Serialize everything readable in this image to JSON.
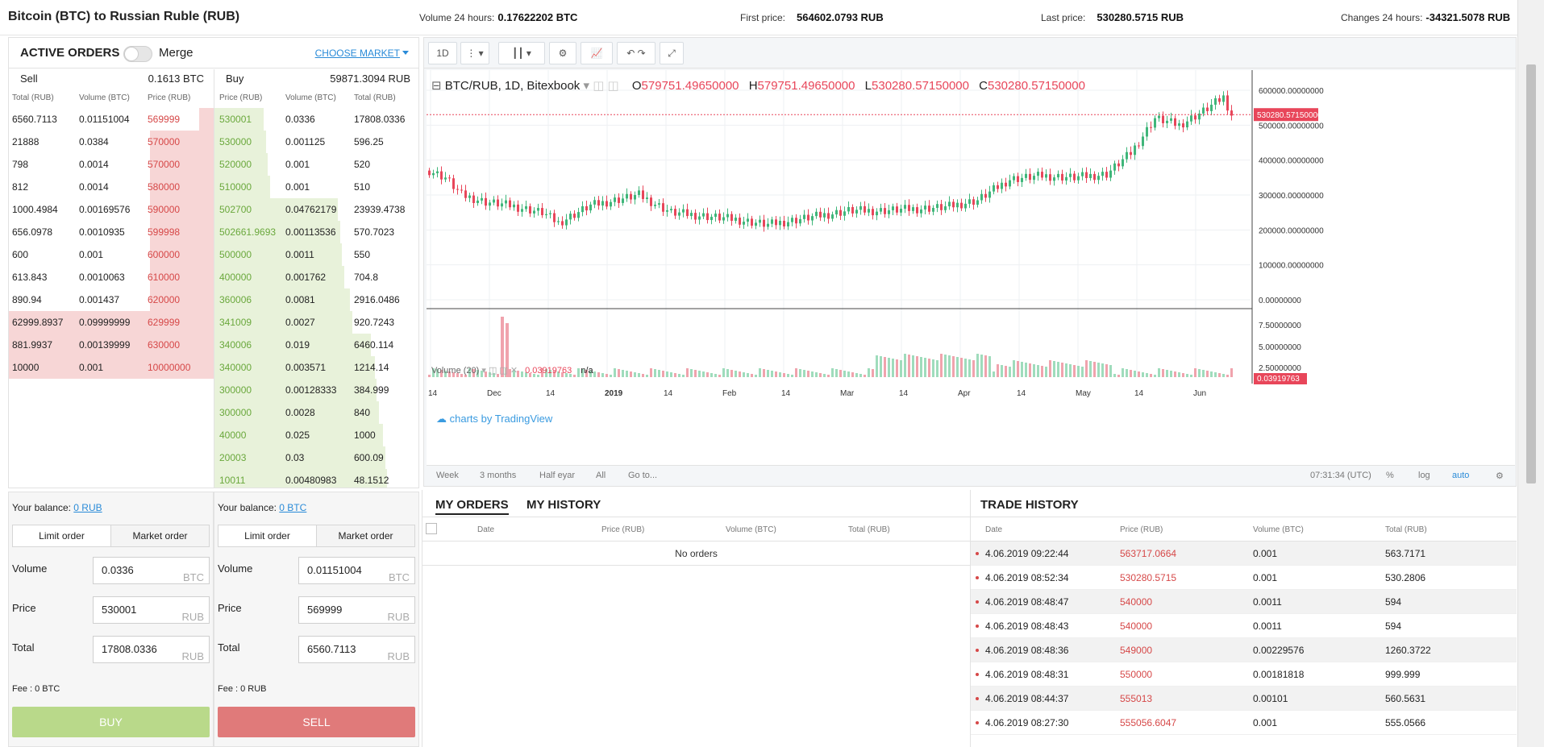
{
  "header": {
    "title": "Bitcoin (BTC) to Russian Ruble (RUB)",
    "volume_label": "Volume 24 hours:",
    "volume_value": "0.17622202 BTC",
    "first_label": "First price:",
    "first_value": "564602.0793 RUB",
    "last_label": "Last price:",
    "last_value": "530280.5715 RUB",
    "change_label": "Changes 24 hours:",
    "change_value": "-34321.5078 RUB"
  },
  "orders": {
    "title": "ACTIVE ORDERS",
    "merge_label": "Merge",
    "choose_market": "CHOOSE MARKET",
    "sell": {
      "label": "Sell",
      "amount": "0.1613 BTC",
      "columns": [
        "Total (RUB)",
        "Volume (BTC)",
        "Price (RUB)"
      ],
      "rows": [
        {
          "total": "6560.7113",
          "volume": "0.01151004",
          "price": "569999",
          "depth": 0.07
        },
        {
          "total": "21888",
          "volume": "0.0384",
          "price": "570000",
          "depth": 0.31
        },
        {
          "total": "798",
          "volume": "0.0014",
          "price": "570000",
          "depth": 0.31
        },
        {
          "total": "812",
          "volume": "0.0014",
          "price": "580000",
          "depth": 0.31
        },
        {
          "total": "1000.4984",
          "volume": "0.00169576",
          "price": "590000",
          "depth": 0.31
        },
        {
          "total": "656.0978",
          "volume": "0.0010935",
          "price": "599998",
          "depth": 0.31
        },
        {
          "total": "600",
          "volume": "0.001",
          "price": "600000",
          "depth": 0.31
        },
        {
          "total": "613.843",
          "volume": "0.0010063",
          "price": "610000",
          "depth": 0.31
        },
        {
          "total": "890.94",
          "volume": "0.001437",
          "price": "620000",
          "depth": 0.31
        },
        {
          "total": "62999.8937",
          "volume": "0.09999999",
          "price": "629999",
          "depth": 1.0
        },
        {
          "total": "881.9937",
          "volume": "0.00139999",
          "price": "630000",
          "depth": 1.0
        },
        {
          "total": "10000",
          "volume": "0.001",
          "price": "10000000",
          "depth": 1.0
        }
      ]
    },
    "buy": {
      "label": "Buy",
      "amount": "59871.3094 RUB",
      "columns": [
        "Price (RUB)",
        "Volume (BTC)",
        "Total (RUB)"
      ],
      "rows": [
        {
          "price": "530001",
          "volume": "0.0336",
          "total": "17808.0336",
          "depth": 0.24
        },
        {
          "price": "530000",
          "volume": "0.001125",
          "total": "596.25",
          "depth": 0.25
        },
        {
          "price": "520000",
          "volume": "0.001",
          "total": "520",
          "depth": 0.26
        },
        {
          "price": "510000",
          "volume": "0.001",
          "total": "510",
          "depth": 0.27
        },
        {
          "price": "502700",
          "volume": "0.04762179",
          "total": "23939.4738",
          "depth": 0.6
        },
        {
          "price": "502661.9693",
          "volume": "0.00113536",
          "total": "570.7023",
          "depth": 0.61
        },
        {
          "price": "500000",
          "volume": "0.0011",
          "total": "550",
          "depth": 0.62
        },
        {
          "price": "400000",
          "volume": "0.001762",
          "total": "704.8",
          "depth": 0.63
        },
        {
          "price": "360006",
          "volume": "0.0081",
          "total": "2916.0486",
          "depth": 0.66
        },
        {
          "price": "341009",
          "volume": "0.0027",
          "total": "920.7243",
          "depth": 0.67
        },
        {
          "price": "340006",
          "volume": "0.019",
          "total": "6460.114",
          "depth": 0.76
        },
        {
          "price": "340000",
          "volume": "0.003571",
          "total": "1214.14",
          "depth": 0.78
        },
        {
          "price": "300000",
          "volume": "0.00128333",
          "total": "384.999",
          "depth": 0.79
        },
        {
          "price": "300000",
          "volume": "0.0028",
          "total": "840",
          "depth": 0.8
        },
        {
          "price": "40000",
          "volume": "0.025",
          "total": "1000",
          "depth": 0.82
        },
        {
          "price": "20003",
          "volume": "0.03",
          "total": "600.09",
          "depth": 0.83
        },
        {
          "price": "10011",
          "volume": "0.00480983",
          "total": "48.1512",
          "depth": 0.84
        }
      ]
    }
  },
  "chart": {
    "toolbar": {
      "interval": "1D"
    },
    "legend": {
      "symbol": "BTC/RUB, 1D, Bitexbook",
      "o_label": "O",
      "o": "579751.49650000",
      "h_label": "H",
      "h": "579751.49650000",
      "l_label": "L",
      "l": "530280.57150000",
      "c_label": "C",
      "c": "530280.57150000"
    },
    "price_axis": [
      "600000.00000000",
      "500000.00000000",
      "400000.00000000",
      "300000.00000000",
      "200000.00000000",
      "100000.00000000",
      "0.00000000"
    ],
    "last_price_tag": "530280.57150000",
    "volume_label": "Volume (20)",
    "volume_value": "0.03919763",
    "volume_na": "n/a",
    "volume_axis": [
      "7.50000000",
      "5.00000000",
      "2.50000000"
    ],
    "volume_tag": "0.03919763",
    "watermark": "charts by TradingView",
    "time_axis": [
      "14",
      "Dec",
      "14",
      "2019",
      "14",
      "Feb",
      "14",
      "Mar",
      "14",
      "Apr",
      "14",
      "May",
      "14",
      "Jun"
    ],
    "bottom": {
      "week": "Week",
      "three_months": "3 months",
      "half_year": "Half eyar",
      "all": "All",
      "goto": "Go to...",
      "time": "07:31:34 (UTC)",
      "percent": "%",
      "log": "log",
      "auto": "auto"
    }
  },
  "balances": [
    {
      "label": "Your balance:",
      "value": "0 RUB",
      "tab_limit": "Limit order",
      "tab_market": "Market order",
      "volume_label": "Volume",
      "volume": "0.0336",
      "volume_unit": "BTC",
      "price_label": "Price",
      "price": "530001",
      "price_unit": "RUB",
      "total_label": "Total",
      "total": "17808.0336",
      "total_unit": "RUB",
      "fee": "Fee : 0  BTC",
      "action": "BUY",
      "color": "#b9d98a"
    },
    {
      "label": "Your balance:",
      "value": "0 BTC",
      "tab_limit": "Limit order",
      "tab_market": "Market order",
      "volume_label": "Volume",
      "volume": "0.01151004",
      "volume_unit": "BTC",
      "price_label": "Price",
      "price": "569999",
      "price_unit": "RUB",
      "total_label": "Total",
      "total": "6560.7113",
      "total_unit": "RUB",
      "fee": "Fee : 0  RUB",
      "action": "SELL",
      "color": "#e07a7a"
    }
  ],
  "my_orders": {
    "tab_orders": "MY ORDERS",
    "tab_history": "MY HISTORY",
    "columns": [
      "Date",
      "Price (RUB)",
      "Volume (BTC)",
      "Total (RUB)"
    ],
    "empty": "No orders"
  },
  "trade_history": {
    "title": "TRADE HISTORY",
    "columns": [
      "Date",
      "Price (RUB)",
      "Volume (BTC)",
      "Total (RUB)"
    ],
    "rows": [
      {
        "date": "4.06.2019 09:22:44",
        "price": "563717.0664",
        "volume": "0.001",
        "total": "563.7171"
      },
      {
        "date": "4.06.2019 08:52:34",
        "price": "530280.5715",
        "volume": "0.001",
        "total": "530.2806"
      },
      {
        "date": "4.06.2019 08:48:47",
        "price": "540000",
        "volume": "0.0011",
        "total": "594"
      },
      {
        "date": "4.06.2019 08:48:43",
        "price": "540000",
        "volume": "0.0011",
        "total": "594"
      },
      {
        "date": "4.06.2019 08:48:36",
        "price": "549000",
        "volume": "0.00229576",
        "total": "1260.3722"
      },
      {
        "date": "4.06.2019 08:48:31",
        "price": "550000",
        "volume": "0.00181818",
        "total": "999.999"
      },
      {
        "date": "4.06.2019 08:44:37",
        "price": "555013",
        "volume": "0.00101",
        "total": "560.5631"
      },
      {
        "date": "4.06.2019 08:27:30",
        "price": "555056.6047",
        "volume": "0.001",
        "total": "555.0566"
      }
    ]
  },
  "colors": {
    "up": "#3fb67a",
    "down": "#e8465a",
    "sell": "#d64848",
    "buy": "#6aa83c",
    "link": "#2a8bd8"
  }
}
